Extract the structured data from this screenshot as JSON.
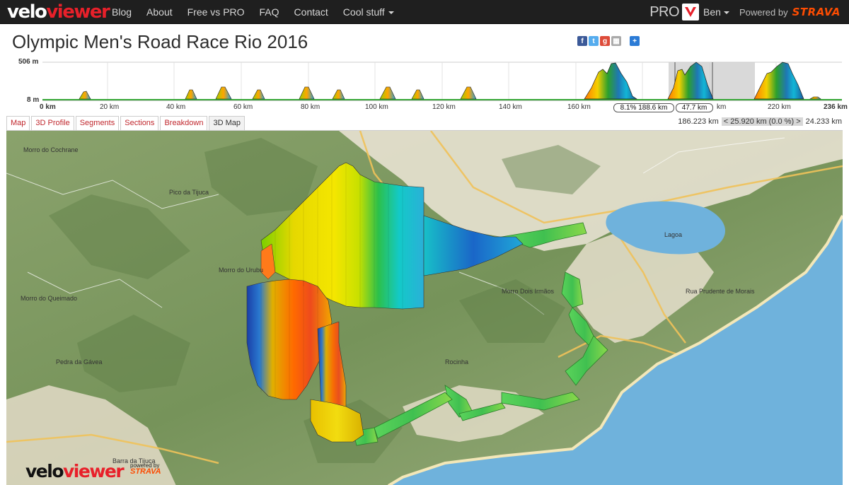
{
  "navbar": {
    "brand_velo": "velo",
    "brand_viewer": "viewer",
    "links": [
      "Blog",
      "About",
      "Free vs PRO",
      "FAQ",
      "Contact",
      "Cool stuff"
    ],
    "pro_label": "PRO",
    "user": "Ben",
    "powered_by": "Powered by",
    "strava": "STRAVA"
  },
  "title": "Olympic Men's Road Race Rio 2016",
  "share_icons": [
    "facebook-icon",
    "twitter-icon",
    "googleplus-icon",
    "delicious-icon",
    "addthis-icon"
  ],
  "elevation": {
    "max_label": "506 m",
    "min_label": "8 m",
    "km_ticks": [
      "0 km",
      "20 km",
      "40 km",
      "60 km",
      "80 km",
      "100 km",
      "120 km",
      "140 km",
      "160 km",
      "220 km",
      "236 km"
    ],
    "selection_grade": "8.1% 188.6 km",
    "selection_length": "47.7 km",
    "selection_unit": "km"
  },
  "tabs": [
    "Map",
    "3D Profile",
    "Segments",
    "Sections",
    "Breakdown",
    "3D Map"
  ],
  "active_tab": "3D Map",
  "range": {
    "start": "186.223 km",
    "middle": "< 25.920 km (0.0 %) >",
    "end": "24.233 km"
  },
  "watermark": {
    "velo": "velo",
    "viewer": "viewer",
    "powered": "powered by",
    "strava": "STRAVA"
  },
  "map_labels": [
    "Morro do Cochrane",
    "Pedra da Gávea",
    "Barra da Tijuca",
    "Lagoa",
    "Rua Prudente de Morais",
    "Morro Dois Irmãos",
    "Pico da Tijuca",
    "Rocinha",
    "Morro do Queimado",
    "Morro do Urubu"
  ],
  "colors": {
    "navbar": "#1f1f1f",
    "brand_red": "#e8202a",
    "strava": "#fc4c02",
    "tab_red": "#c0272d",
    "ocean": "#6fb2dc",
    "forest": "#7e9a62"
  }
}
